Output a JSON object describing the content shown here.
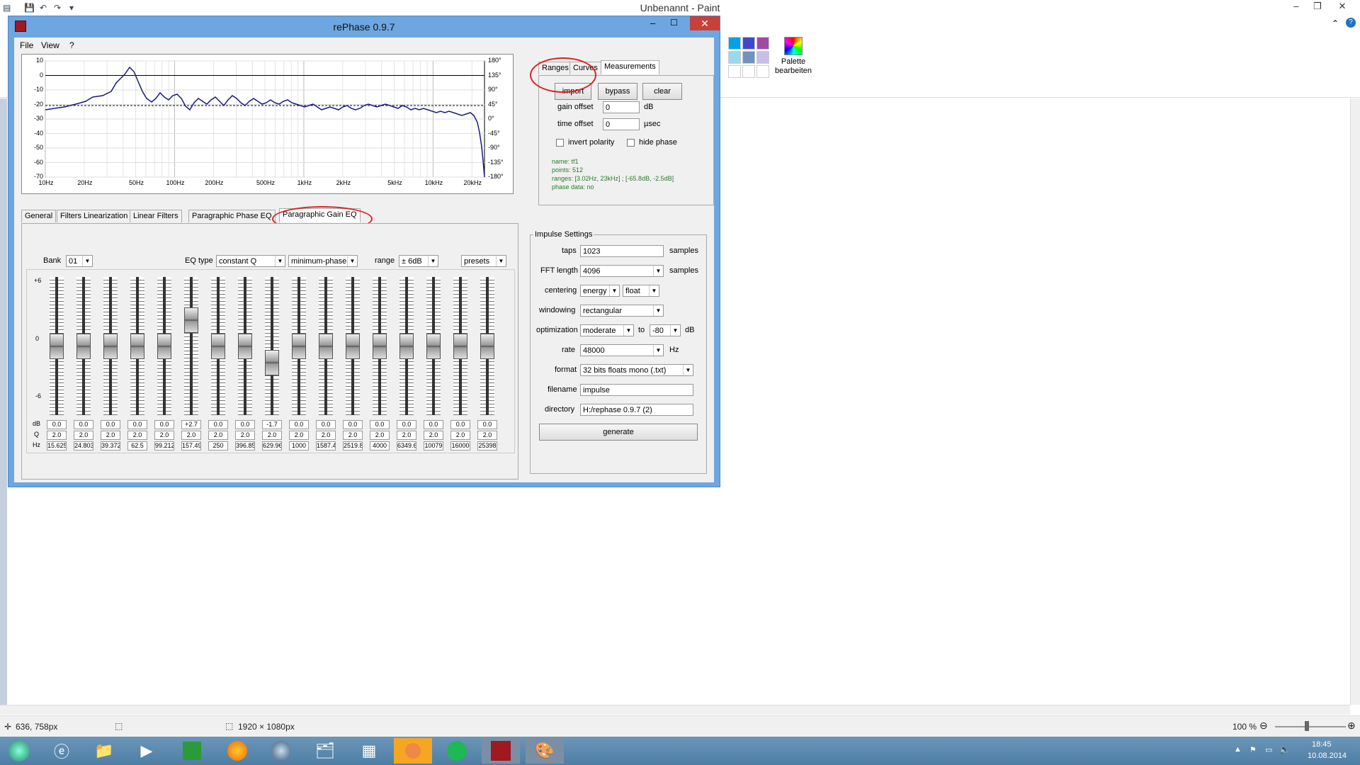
{
  "paint": {
    "title": "Unbenannt - Paint",
    "palette_label": "Palette bearbeiten",
    "palette_colors": [
      "#00a2e8",
      "#3f48cc",
      "#a349a4",
      "#99d9ea",
      "#7092be",
      "#c8bfe7",
      "#ffffff",
      "#ffffff",
      "#ffffff"
    ],
    "status_pos": "636, 758px",
    "status_size": "1920 × 1080px",
    "zoom": "100 %",
    "time": "18:45",
    "date": "10.08.2014"
  },
  "rephase": {
    "title": "rePhase 0.9.7",
    "menu": [
      "File",
      "View",
      "?"
    ],
    "graph": {
      "y_left": [
        "10",
        "0",
        "-10",
        "-20",
        "-30",
        "-40",
        "-50",
        "-60",
        "-70"
      ],
      "y_right": [
        "180°",
        "135°",
        "90°",
        "45°",
        "0°",
        "-45°",
        "-90°",
        "-135°",
        "-180°"
      ],
      "x": [
        "10Hz",
        "20Hz",
        "50Hz",
        "100Hz",
        "200Hz",
        "500Hz",
        "1kHz",
        "2kHz",
        "5kHz",
        "10kHz",
        "20kHz"
      ]
    },
    "top_tabs": [
      "Ranges",
      "Curves",
      "Measurements"
    ],
    "measure": {
      "import": "import",
      "bypass": "bypass",
      "clear": "clear",
      "gain_offset_label": "gain offset",
      "gain_offset": "0",
      "gain_unit": "dB",
      "time_offset_label": "time offset",
      "time_offset": "0",
      "time_unit": "µsec",
      "invert_polarity": "invert polarity",
      "hide_phase": "hide phase",
      "info": [
        "name: tf1",
        "points: 512",
        "ranges: [3.02Hz, 23kHz] ; [-65.8dB, -2.5dB]",
        "phase data: no"
      ]
    },
    "eq_tabs": [
      "General",
      "Filters Linearization",
      "Linear Filters",
      "Paragraphic Phase EQ",
      "Paragraphic Gain EQ"
    ],
    "eq": {
      "bank_label": "Bank",
      "bank": "01",
      "eq_type_label": "EQ type",
      "eq_type": "constant Q",
      "phase_type": "minimum-phase",
      "range_label": "range",
      "range": "± 6dB",
      "presets": "presets",
      "scale": [
        "+6",
        "0",
        "-6"
      ],
      "row_labels": [
        "dB",
        "Q",
        "Hz"
      ],
      "db": [
        "0.0",
        "0.0",
        "0.0",
        "0.0",
        "0.0",
        "+2.7",
        "0.0",
        "0.0",
        "-1.7",
        "0.0",
        "0.0",
        "0.0",
        "0.0",
        "0.0",
        "0.0",
        "0.0",
        "0.0"
      ],
      "q": [
        "2.0",
        "2.0",
        "2.0",
        "2.0",
        "2.0",
        "2.0",
        "2.0",
        "2.0",
        "2.0",
        "2.0",
        "2.0",
        "2.0",
        "2.0",
        "2.0",
        "2.0",
        "2.0",
        "2.0"
      ],
      "hz": [
        "15.625",
        "24.803",
        "39.372",
        "62.5",
        "99.212",
        "157.49",
        "250",
        "396.85",
        "629.96",
        "1000",
        "1587.4",
        "2519.8",
        "4000",
        "6349.6",
        "10079",
        "16000",
        "25398"
      ]
    },
    "impulse": {
      "title": "Impulse Settings",
      "taps_label": "taps",
      "taps": "1023",
      "taps_unit": "samples",
      "fft_label": "FFT length",
      "fft": "4096",
      "fft_unit": "samples",
      "centering_label": "centering",
      "centering": "energy",
      "centering2": "float",
      "windowing_label": "windowing",
      "windowing": "rectangular",
      "optimization_label": "optimization",
      "optimization": "moderate",
      "to_label": "to",
      "opt_db": "-80",
      "opt_unit": "dB",
      "rate_label": "rate",
      "rate": "48000",
      "rate_unit": "Hz",
      "format_label": "format",
      "format": "32 bits floats mono (.txt)",
      "filename_label": "filename",
      "filename": "impulse",
      "directory_label": "directory",
      "directory": "H:/rephase 0.9.7 (2)",
      "generate": "generate"
    }
  }
}
